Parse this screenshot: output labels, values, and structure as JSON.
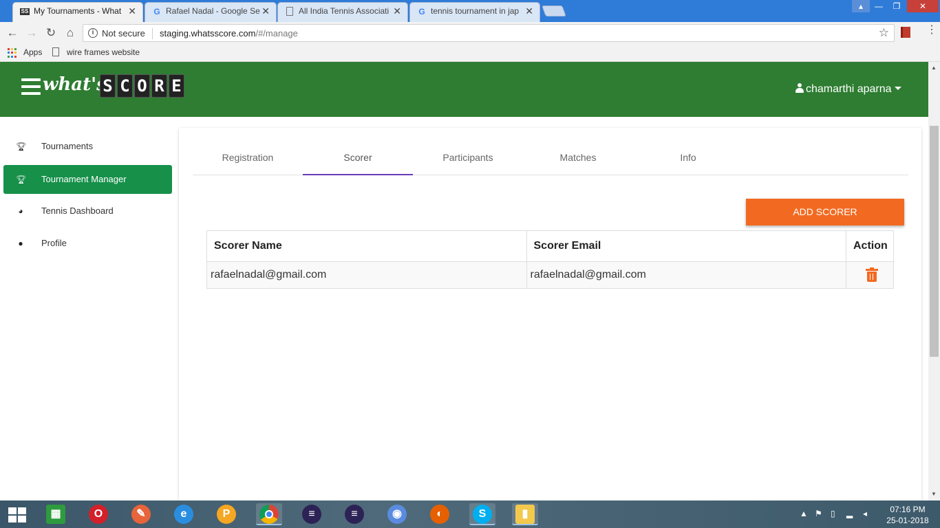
{
  "browser": {
    "tabs": [
      {
        "title": "My Tournaments - What",
        "active": true
      },
      {
        "title": "Rafael Nadal - Google Se",
        "active": false
      },
      {
        "title": "All India Tennis Associati",
        "active": false
      },
      {
        "title": "tennis tournament in jap",
        "active": false
      }
    ],
    "address": {
      "security": "Not secure",
      "host": "staging.whatsscore.com",
      "path": "/#/manage"
    },
    "bookmarks": {
      "apps": "Apps",
      "item1": "wire frames website"
    }
  },
  "header": {
    "logo_prefix": "what's",
    "logo_score": [
      "S",
      "C",
      "O",
      "R",
      "E"
    ],
    "user_name": "chamarthi aparna"
  },
  "sidebar": {
    "items": [
      {
        "label": "Tournaments",
        "icon": "trophy-icon",
        "active": false
      },
      {
        "label": "Tournament Manager",
        "icon": "trophy-icon",
        "active": true
      },
      {
        "label": "Tennis Dashboard",
        "icon": "dashboard-icon",
        "active": false
      },
      {
        "label": "Profile",
        "icon": "user-icon",
        "active": false
      }
    ]
  },
  "main": {
    "tabs": [
      {
        "label": "Registration",
        "active": false
      },
      {
        "label": "Scorer",
        "active": true
      },
      {
        "label": "Participants",
        "active": false
      },
      {
        "label": "Matches",
        "active": false
      },
      {
        "label": "Info",
        "active": false
      }
    ],
    "add_button": "ADD SCORER",
    "table": {
      "headers": [
        "Scorer Name",
        "Scorer Email",
        "Action"
      ],
      "rows": [
        {
          "name": "rafaelnadal@gmail.com",
          "email": "rafaelnadal@gmail.com"
        }
      ]
    }
  },
  "colors": {
    "header_green": "#2e7d32",
    "sidebar_active": "#17904a",
    "accent_orange": "#f26a21",
    "tab_indicator": "#673ab7"
  },
  "taskbar": {
    "time": "07:16 PM",
    "date": "25-01-2018"
  }
}
